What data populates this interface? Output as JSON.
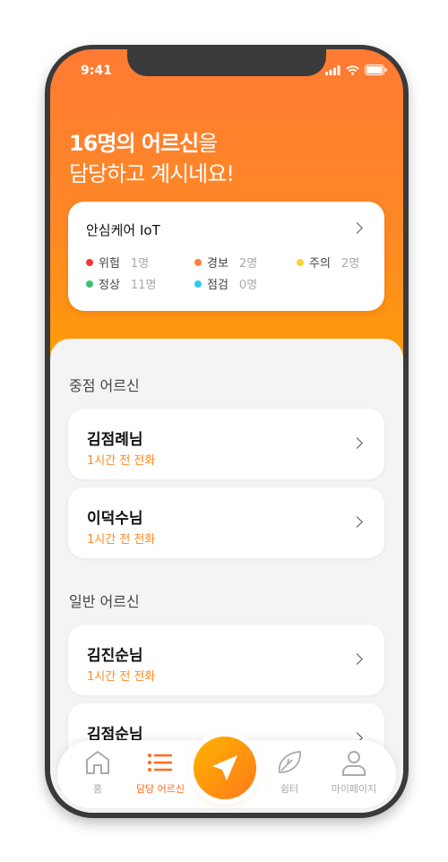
{
  "status_bar": {
    "time": "9:41"
  },
  "header": {
    "count_text": "16명의 어르신",
    "line1_suffix": "을",
    "line2": "담당하고 계시네요!"
  },
  "iot_card": {
    "title": "안심케어 IoT",
    "stats": [
      {
        "label": "위험",
        "count": "1명",
        "color": "#f03a3a"
      },
      {
        "label": "경보",
        "count": "2명",
        "color": "#ff8040"
      },
      {
        "label": "주의",
        "count": "2명",
        "color": "#ffd030"
      },
      {
        "label": "정상",
        "count": "11명",
        "color": "#40c070"
      },
      {
        "label": "점검",
        "count": "0명",
        "color": "#30c8f8"
      }
    ]
  },
  "sections": [
    {
      "title": "중점 어르신",
      "items": [
        {
          "name": "김점례님",
          "sub": "1시간 전 전화"
        },
        {
          "name": "이덕수님",
          "sub": "1시간 전 전화"
        }
      ]
    },
    {
      "title": "일반 어르신",
      "items": [
        {
          "name": "김진순님",
          "sub": "1시간 전 전화"
        },
        {
          "name": "김점순님",
          "sub": ""
        }
      ]
    }
  ],
  "tabbar": {
    "items": [
      {
        "label": "홈",
        "icon": "home-icon"
      },
      {
        "label": "담당 어르신",
        "icon": "list-icon",
        "active": true
      },
      {
        "label": "",
        "icon": "send-icon"
      },
      {
        "label": "쉼터",
        "icon": "leaf-icon"
      },
      {
        "label": "마이페이지",
        "icon": "person-icon"
      }
    ]
  },
  "colors": {
    "accent": "#ff8a24",
    "active_tab": "#ff6a1a"
  }
}
